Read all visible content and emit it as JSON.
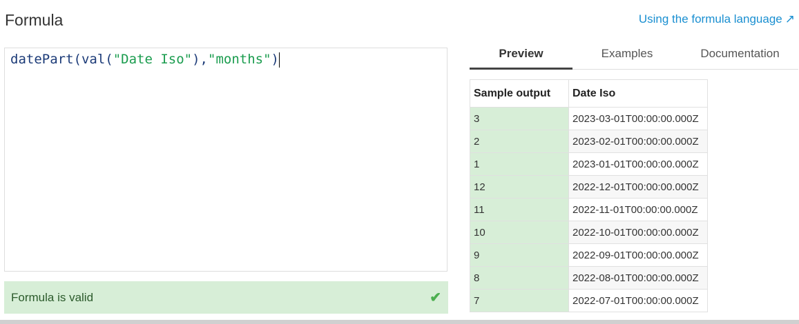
{
  "header": {
    "title": "Formula",
    "help_link": "Using the formula language"
  },
  "editor": {
    "fn1": "datePart(",
    "fn2": "val(",
    "arg1": "\"Date Iso\"",
    "sep": "),",
    "arg2": "\"months\"",
    "close": ")"
  },
  "status": {
    "text": "Formula is valid"
  },
  "tabs": [
    {
      "label": "Preview"
    },
    {
      "label": "Examples"
    },
    {
      "label": "Documentation"
    }
  ],
  "table": {
    "headers": [
      "Sample output",
      "Date Iso"
    ],
    "rows": [
      [
        "3",
        "2023-03-01T00:00:00.000Z"
      ],
      [
        "2",
        "2023-02-01T00:00:00.000Z"
      ],
      [
        "1",
        "2023-01-01T00:00:00.000Z"
      ],
      [
        "12",
        "2022-12-01T00:00:00.000Z"
      ],
      [
        "11",
        "2022-11-01T00:00:00.000Z"
      ],
      [
        "10",
        "2022-10-01T00:00:00.000Z"
      ],
      [
        "9",
        "2022-09-01T00:00:00.000Z"
      ],
      [
        "8",
        "2022-08-01T00:00:00.000Z"
      ],
      [
        "7",
        "2022-07-01T00:00:00.000Z"
      ]
    ]
  }
}
